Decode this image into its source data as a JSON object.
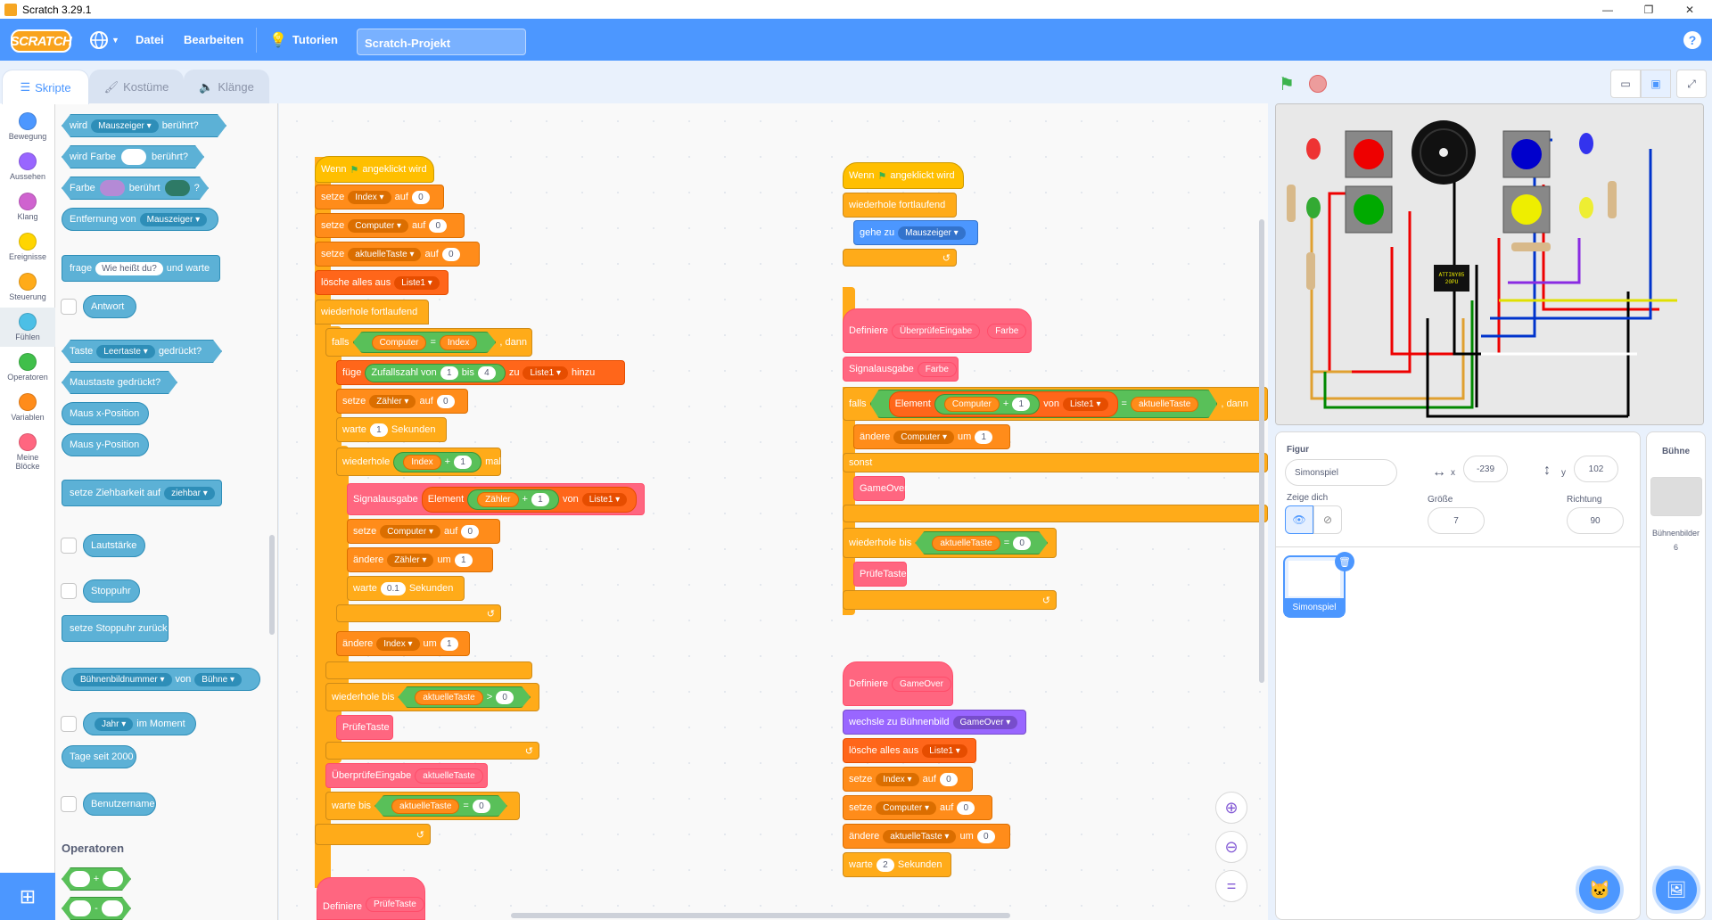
{
  "window": {
    "title": "Scratch 3.29.1",
    "minimize": "—",
    "maximize": "❐",
    "close": "✕"
  },
  "menu": {
    "logo": "SCRATCH",
    "file": "Datei",
    "edit": "Bearbeiten",
    "tutorials": "Tutorien",
    "project_name": "Scratch-Projekt",
    "help": "?"
  },
  "tabs": {
    "code": "Skripte",
    "costumes": "Kostüme",
    "sounds": "Klänge"
  },
  "categories": [
    {
      "label": "Bewegung",
      "color": "#4c97ff"
    },
    {
      "label": "Aussehen",
      "color": "#9966ff"
    },
    {
      "label": "Klang",
      "color": "#cf63cf"
    },
    {
      "label": "Ereignisse",
      "color": "#ffd500"
    },
    {
      "label": "Steuerung",
      "color": "#ffab19"
    },
    {
      "label": "Fühlen",
      "color": "#4cbfe6"
    },
    {
      "label": "Operatoren",
      "color": "#40bf4a"
    },
    {
      "label": "Variablen",
      "color": "#ff8c1a"
    },
    {
      "label": "Meine Blöcke",
      "color": "#ff6680"
    }
  ],
  "palette": {
    "touching": "wird",
    "touching_menu": "Mauszeiger",
    "touching_end": "berührt?",
    "touch_color": "wird Farbe",
    "touch_color_end": "berührt?",
    "color_a": "Farbe",
    "color_b": "berührt",
    "color_q": "?",
    "distance": "Entfernung von",
    "distance_menu": "Mauszeiger",
    "ask": "frage",
    "ask_text": "Wie heißt du?",
    "ask_end": "und warte",
    "answer": "Antwort",
    "key": "Taste",
    "key_menu": "Leertaste",
    "key_end": "gedrückt?",
    "mouse_down": "Maustaste gedrückt?",
    "mouse_x": "Maus x-Position",
    "mouse_y": "Maus y-Position",
    "drag": "setze Ziehbarkeit auf",
    "drag_menu": "ziehbar",
    "loudness": "Lautstärke",
    "timer": "Stoppuhr",
    "reset_timer": "setze Stoppuhr zurück",
    "backdrop_num": "Bühnenbildnummer",
    "of": "von",
    "of_menu": "Bühne",
    "current": "im Moment",
    "current_menu": "Jahr",
    "days": "Tage seit 2000",
    "username": "Benutzername",
    "operators_heading": "Operatoren",
    "plus": "+",
    "minus": "-"
  },
  "script1": {
    "hat": "Wenn",
    "hat_end": "angeklickt wird",
    "set": "setze",
    "to": "auf",
    "v_index": "Index",
    "v_computer": "Computer",
    "v_key": "aktuelleTaste",
    "zero": "0",
    "delete_all": "lösche alles aus",
    "list": "Liste1",
    "forever": "wiederhole fortlaufend",
    "if": "falls",
    "then": ", dann",
    "eq": "=",
    "add": "füge",
    "random": "Zufallszahl von",
    "one": "1",
    "bis": "bis",
    "four": "4",
    "zu": "zu",
    "hinzu": "hinzu",
    "v_counter": "Zähler",
    "wait": "warte",
    "seconds": "Sekunden",
    "repeat": "wiederhole",
    "plus": "+",
    "times": "mal",
    "signal": "Signalausgabe",
    "element": "Element",
    "von": "von",
    "change": "ändere",
    "by": "um",
    "point_one": "0.1",
    "repeat_until": "wiederhole bis",
    "gt": ">",
    "check_key": "PrüfeTaste",
    "check_input": "ÜberprüfeEingabe",
    "wait_until": "warte bis",
    "define": "Definiere"
  },
  "script2": {
    "hat": "Wenn",
    "hat_end": "angeklickt wird",
    "forever": "wiederhole fortlaufend",
    "goto": "gehe zu",
    "goto_menu": "Mauszeiger"
  },
  "script3": {
    "define": "Definiere",
    "name": "ÜberprüfeEingabe",
    "param": "Farbe",
    "signal": "Signalausgabe",
    "if": "falls",
    "element": "Element",
    "v_computer": "Computer",
    "plus": "+",
    "one": "1",
    "von": "von",
    "list": "Liste1",
    "eq": "=",
    "v_key": "aktuelleTaste",
    "then": ", dann",
    "change": "ändere",
    "by": "um",
    "else": "sonst",
    "game_over": "GameOver",
    "repeat_until": "wiederhole bis",
    "zero": "0",
    "check_key": "PrüfeTaste"
  },
  "script4": {
    "define": "Definiere",
    "name": "GameOver",
    "switch": "wechsle zu Bühnenbild",
    "switch_menu": "GameOver",
    "delete_all": "lösche alles aus",
    "list": "Liste1",
    "set": "setze",
    "to": "auf",
    "v_index": "Index",
    "v_computer": "Computer",
    "v_key": "aktuelleTaste",
    "change": "ändere",
    "by": "um",
    "zero": "0",
    "wait": "warte",
    "two": "2",
    "seconds": "Sekunden"
  },
  "sprite": {
    "label": "Figur",
    "name": "Simonspiel",
    "x_label": "x",
    "x": "-239",
    "y_label": "y",
    "y": "102",
    "show_label": "Zeige dich",
    "size_label": "Größe",
    "size": "7",
    "dir_label": "Richtung",
    "direction": "90",
    "thumb_name": "Simonspiel"
  },
  "stage_pane": {
    "label": "Bühne",
    "backdrops_label": "Bühnenbilder",
    "backdrops": "6"
  },
  "chip": {
    "line1": "ATTINY85",
    "line2": "20PU"
  },
  "colors": {
    "accent": "#4c97ff",
    "events": "#ffbf00",
    "control": "#ffab19",
    "variables": "#ff8c1a",
    "lists": "#ff661a",
    "myblocks": "#ff6680",
    "operators": "#59c059",
    "looks": "#9966ff",
    "sensing": "#5cb1d6"
  }
}
